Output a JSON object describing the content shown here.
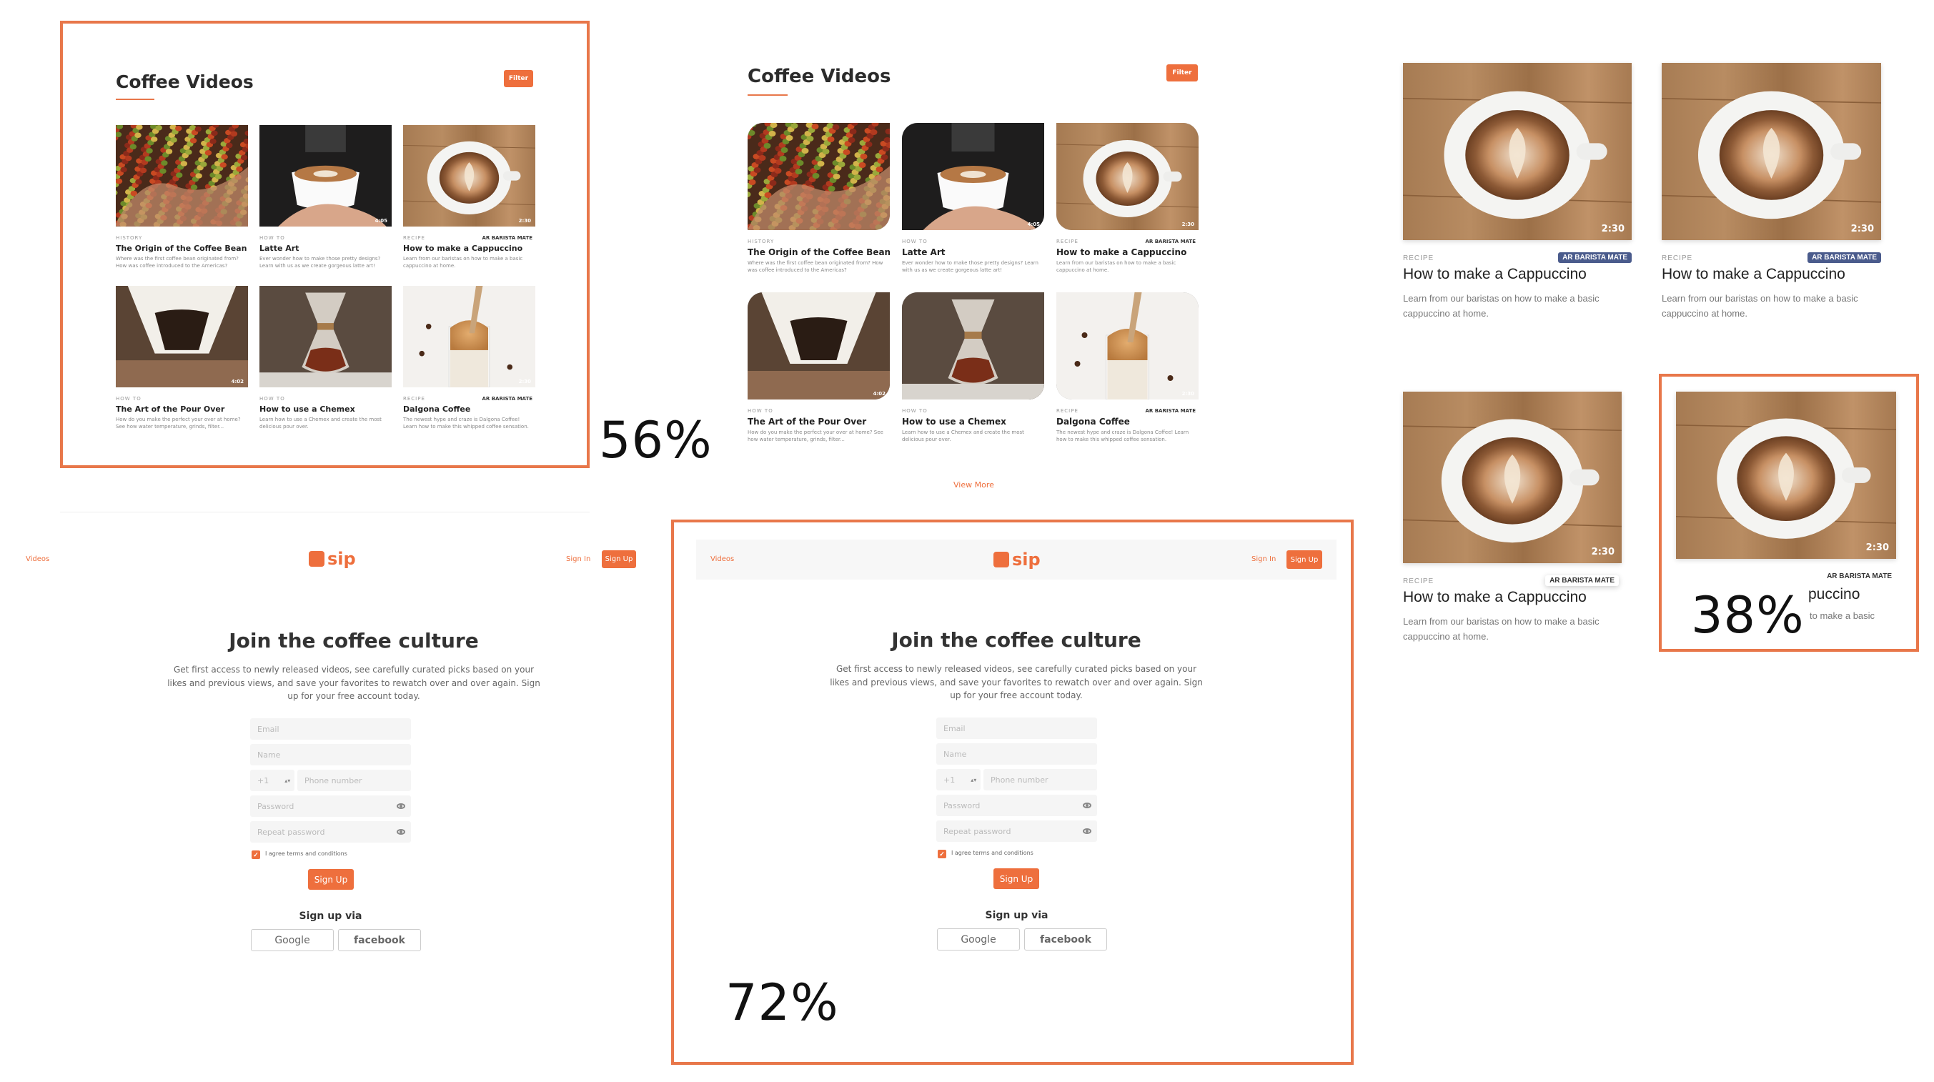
{
  "percent_a": "56%",
  "percent_b": "72%",
  "percent_c": "38%",
  "videos": {
    "title": "Coffee Videos",
    "filter_label": "Filter",
    "view_more": "View More",
    "cards": [
      {
        "category": "HISTORY",
        "badge": "",
        "title": "The Origin of the Coffee Bean",
        "desc": "Where was the first coffee bean originated from? How was coffee introduced to the Americas?",
        "duration": "",
        "image": "beans"
      },
      {
        "category": "HOW TO",
        "badge": "",
        "title": "Latte Art",
        "desc": "Ever wonder how to make those pretty designs? Learn with us as we create gorgeous latte art!",
        "duration": "4:05",
        "image": "latte"
      },
      {
        "category": "RECIPE",
        "badge": "AR BARISTA MATE",
        "title": "How to make a Cappuccino",
        "desc": "Learn from our baristas on how to make a basic cappuccino at home.",
        "duration": "2:30",
        "image": "cappuccino"
      },
      {
        "category": "HOW TO",
        "badge": "",
        "title": "The Art of the Pour Over",
        "desc": "How do you make the perfect your over at home? See how water temperature, grinds, filter...",
        "duration": "4:02",
        "image": "pourover"
      },
      {
        "category": "HOW TO",
        "badge": "",
        "title": "How to use a Chemex",
        "desc": "Learn how to use a Chemex and create the most delicious pour over.",
        "duration": "",
        "image": "chemex"
      },
      {
        "category": "RECIPE",
        "badge": "AR BARISTA MATE",
        "title": "Dalgona Coffee",
        "desc": "The newest hype and craze is Dalgona Coffee! Learn how to make this whipped coffee sensation.",
        "duration": "2:30",
        "image": "dalgona"
      }
    ]
  },
  "signup": {
    "nav_videos": "Videos",
    "logo_text": "sip",
    "sign_in": "Sign In",
    "sign_up": "Sign Up",
    "heading": "Join the coffee culture",
    "lead": "Get first access to newly released videos, see carefully curated picks based on your likes and previous views, and save your favorites to rewatch over and over again.  Sign up for your free account today.",
    "email_placeholder": "Email",
    "name_placeholder": "Name",
    "country_code": "+1",
    "phone_placeholder": "Phone number",
    "password_placeholder": "Password",
    "repeat_password_placeholder": "Repeat password",
    "agree_label": "I agree terms and conditions",
    "submit_label": "Sign Up",
    "via_label": "Sign up via",
    "google_label": "Google",
    "facebook_label": "facebook"
  },
  "large_card": {
    "category": "RECIPE",
    "badge": "AR BARISTA MATE",
    "title": "How to make a Cappuccino",
    "desc": "Learn from our baristas on how to make a basic cappuccino at home.",
    "duration": "2:30",
    "cropped_title": "puccino",
    "cropped_desc": "to make a basic"
  },
  "colors": {
    "accent": "#ee6f3d",
    "frame": "#e8774a",
    "badge_blue": "#4a5b8c"
  }
}
